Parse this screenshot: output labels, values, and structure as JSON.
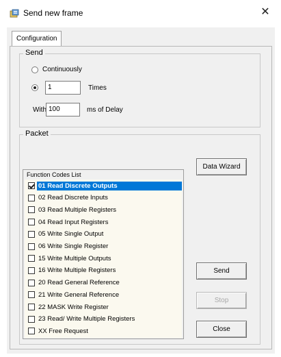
{
  "window": {
    "title": "Send new frame",
    "close_glyph": "✕"
  },
  "tabs": [
    {
      "label": "Configuration"
    }
  ],
  "send_group": {
    "legend": "Send",
    "continuously_label": "Continuously",
    "times_value": "1",
    "times_label": "Times",
    "with_label": "With",
    "delay_value": "100",
    "delay_label": "ms of Delay",
    "selected_mode": "times"
  },
  "packet_group": {
    "legend": "Packet",
    "list_header": "Function Codes List",
    "items": [
      {
        "label": "01 Read Discrete Outputs",
        "checked": true,
        "selected": true
      },
      {
        "label": "02 Read Discrete Inputs",
        "checked": false
      },
      {
        "label": "03 Read Multiple Registers",
        "checked": false
      },
      {
        "label": "04 Read Input Registers",
        "checked": false
      },
      {
        "label": "05 Write Single Output",
        "checked": false
      },
      {
        "label": "06 Write Single Register",
        "checked": false
      },
      {
        "label": "15 Write Multiple Outputs",
        "checked": false
      },
      {
        "label": "16 Write Multiple Registers",
        "checked": false
      },
      {
        "label": "20 Read General Reference",
        "checked": false
      },
      {
        "label": "21 Write General Reference",
        "checked": false
      },
      {
        "label": "22 MASK Write Register",
        "checked": false
      },
      {
        "label": "23 Read/ Write Multiple Registers",
        "checked": false
      },
      {
        "label": "XX Free Request",
        "checked": false
      }
    ]
  },
  "buttons": {
    "data_wizard": "Data Wizard",
    "send": "Send",
    "stop": "Stop",
    "close": "Close"
  },
  "colors": {
    "selection": "#0078d7",
    "list_bg": "#fbf9ef",
    "dialog_bg": "#f0f0f0"
  }
}
